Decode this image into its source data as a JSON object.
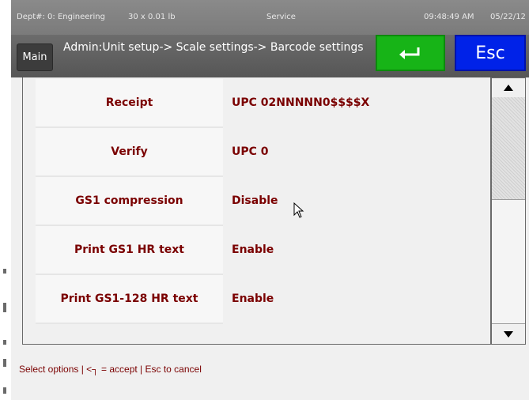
{
  "status": {
    "dept": "Dept#: 0: Engineering",
    "capacity": "30 x 0.01 lb",
    "mode": "Service",
    "time": "09:48:49 AM",
    "date": "05/22/12"
  },
  "header": {
    "main_label": "Main",
    "breadcrumb": "Admin:Unit setup-> Scale settings-> Barcode settings",
    "esc_label": "Esc",
    "accept_icon": "enter-arrow-icon"
  },
  "settings": [
    {
      "label": "Receipt",
      "value": "UPC 02NNNNN0$$$$X"
    },
    {
      "label": "Verify",
      "value": "UPC 0"
    },
    {
      "label": "GS1 compression",
      "value": "Disable"
    },
    {
      "label": "Print GS1 HR text",
      "value": "Enable"
    },
    {
      "label": "Print GS1-128 HR text",
      "value": "Enable"
    }
  ],
  "scrollbar": {
    "up_icon": "triangle-up-icon",
    "down_icon": "triangle-down-icon"
  },
  "footer": {
    "hint": "Select options | <┐ = accept | Esc to cancel"
  },
  "colors": {
    "accept": "#17b417",
    "esc": "#0022e8",
    "text_accent": "#7a0000"
  }
}
